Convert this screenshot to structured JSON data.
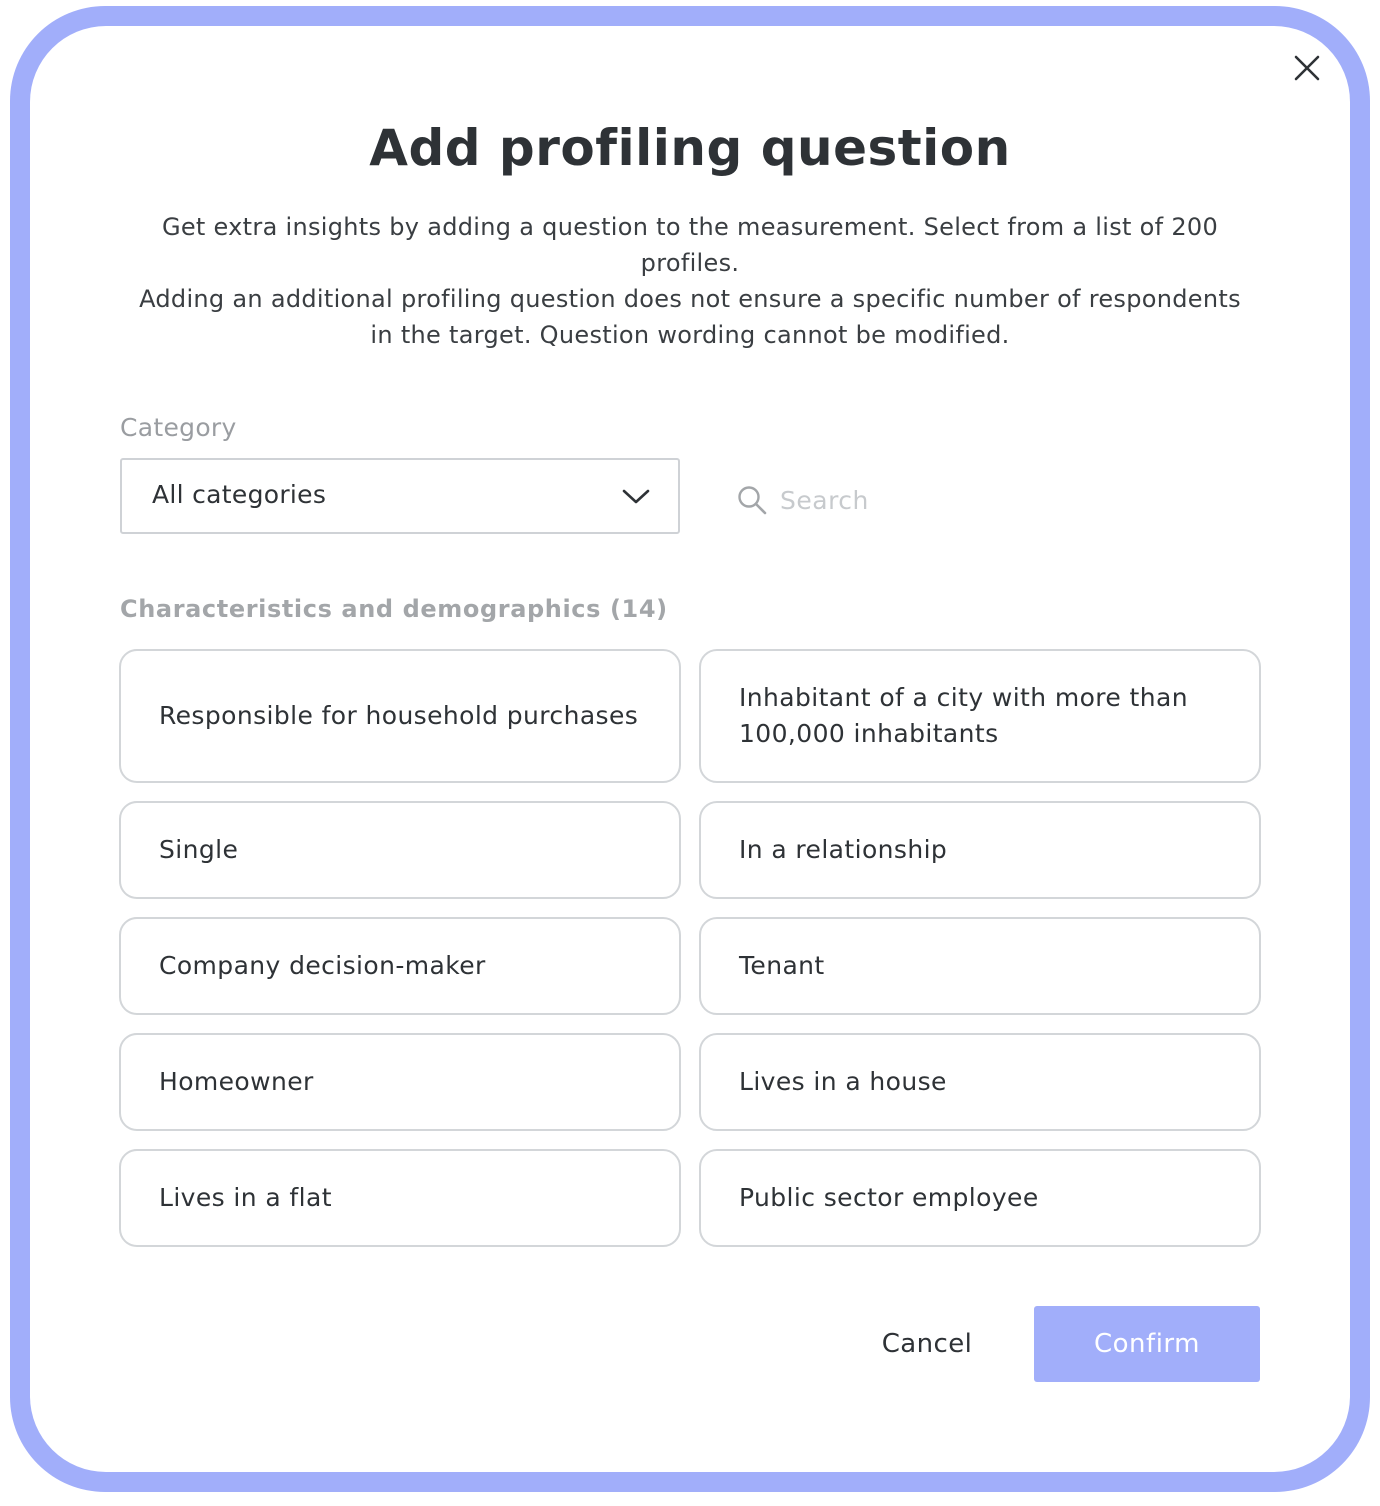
{
  "dialog": {
    "title": "Add profiling question",
    "description_line1": "Get extra insights by adding a question to the measurement. Select from a list of 200 profiles.",
    "description_line2": "Adding an additional profiling question does not ensure a specific number of respondents in the target. Question wording cannot be modified.",
    "close_icon": "close-icon"
  },
  "filters": {
    "category_label": "Category",
    "category_value": "All categories",
    "chevron_icon": "chevron-down-icon",
    "search_icon": "search-icon",
    "search_placeholder": "Search",
    "search_value": ""
  },
  "section": {
    "heading": "Characteristics and demographics (14)",
    "items": [
      {
        "label": "Responsible for household purchases"
      },
      {
        "label": "Inhabitant of a city with more than 100,000 inhabitants"
      },
      {
        "label": "Single"
      },
      {
        "label": "In a relationship"
      },
      {
        "label": "Company decision-maker"
      },
      {
        "label": "Tenant"
      },
      {
        "label": "Homeowner"
      },
      {
        "label": "Lives in a house"
      },
      {
        "label": "Lives in a flat"
      },
      {
        "label": "Public sector employee"
      }
    ]
  },
  "actions": {
    "cancel_label": "Cancel",
    "confirm_label": "Confirm"
  },
  "colors": {
    "accent": "#a1aefa",
    "text": "#2e3236",
    "muted": "#9a9da1",
    "border": "#d3d6d9"
  }
}
